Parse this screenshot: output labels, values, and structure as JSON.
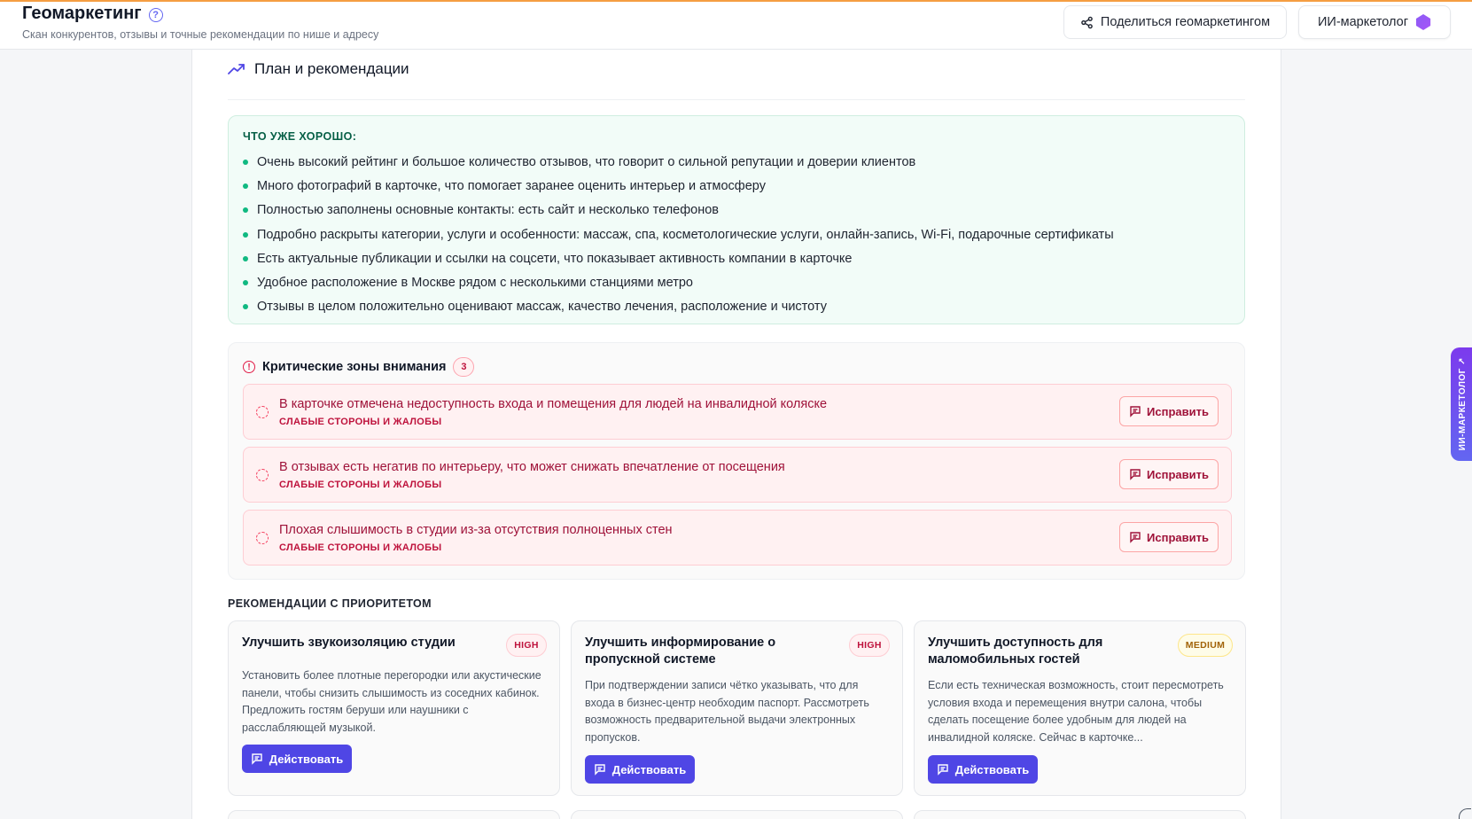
{
  "header": {
    "title": "Геомаркетинг",
    "subtitle": "Скан конкурентов, отзывы и точные рекомендации по нише и адресу",
    "share_label": "Поделиться геомаркетингом",
    "ai_label": "ИИ-маркетолог"
  },
  "section": {
    "title": "План и рекомендации"
  },
  "good": {
    "title": "ЧТО УЖЕ ХОРОШО:",
    "items": [
      "Очень высокий рейтинг и большое количество отзывов, что говорит о сильной репутации и доверии клиентов",
      "Много фотографий в карточке, что помогает заранее оценить интерьер и атмосферу",
      "Полностью заполнены основные контакты: есть сайт и несколько телефонов",
      "Подробно раскрыты категории, услуги и особенности: массаж, спа, косметологические услуги, онлайн-запись, Wi-Fi, подарочные сертификаты",
      "Есть актуальные публикации и ссылки на соцсети, что показывает активность компании в карточке",
      "Удобное расположение в Москве рядом с несколькими станциями метро",
      "Отзывы в целом положительно оценивают массаж, качество лечения, расположение и чистоту"
    ]
  },
  "critical": {
    "title": "Критические зоны внимания",
    "count": "3",
    "items": [
      {
        "text": "В карточке отмечена недоступность входа и помещения для людей на инвалидной коляске",
        "tag": "СЛАБЫЕ СТОРОНЫ И ЖАЛОБЫ",
        "action": "Исправить"
      },
      {
        "text": "В отзывах есть негатив по интерьеру, что может снижать впечатление от посещения",
        "tag": "СЛАБЫЕ СТОРОНЫ И ЖАЛОБЫ",
        "action": "Исправить"
      },
      {
        "text": "Плохая слышимость в студии из-за отсутствия полноценных стен",
        "tag": "СЛАБЫЕ СТОРОНЫ И ЖАЛОБЫ",
        "action": "Исправить"
      }
    ]
  },
  "recommendations": {
    "title": "РЕКОМЕНДАЦИИ С ПРИОРИТЕТОМ",
    "cards": [
      {
        "title": "Улучшить звукоизоляцию студии",
        "priority": "HIGH",
        "desc": "Установить более плотные перегородки или акустические панели, чтобы снизить слышимость из соседних кабинок. Предложить гостям беруши или наушники с расслабляющей музыкой.",
        "action": "Действовать"
      },
      {
        "title": "Улучшить информирование о пропускной системе",
        "priority": "HIGH",
        "desc": "При подтверждении записи чётко указывать, что для входа в бизнес-центр необходим паспорт. Рассмотреть возможность предварительной выдачи электронных пропусков.",
        "action": "Действовать"
      },
      {
        "title": "Улучшить доступность для маломобильных гостей",
        "priority": "MEDIUM",
        "desc": "Если есть техническая возможность, стоит пересмотреть условия входа и перемещения внутри салона, чтобы сделать посещение более удобным для людей на инвалидной коляске. Сейчас в карточке...",
        "action": "Действовать"
      }
    ]
  },
  "side_tab": {
    "label": "ИИ-МАРКЕТОЛОГ ↗"
  },
  "colors": {
    "accent": "#4f46e5",
    "good": "#10b981",
    "critical": "#e11d48",
    "top_bar": "#f59e42"
  }
}
